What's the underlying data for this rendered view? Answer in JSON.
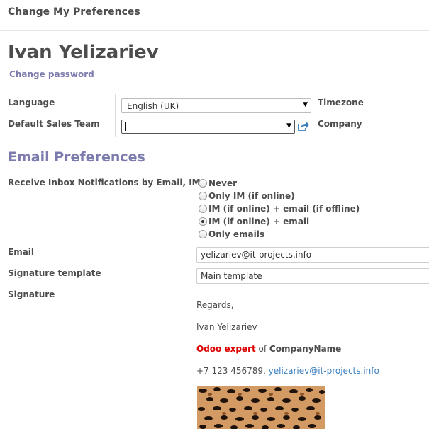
{
  "dialog": {
    "title": "Change My Preferences"
  },
  "user": {
    "name": "Ivan Yelizariev",
    "change_password": "Change password"
  },
  "fields": {
    "language": {
      "label": "Language",
      "value": "English (UK)"
    },
    "default_sales_team": {
      "label": "Default Sales Team",
      "value": ""
    },
    "timezone": {
      "label": "Timezone"
    },
    "company": {
      "label": "Company"
    }
  },
  "email_prefs": {
    "title": "Email Preferences",
    "notify_label": "Receive Inbox Notifications by Email, IM",
    "options": [
      {
        "label": "Never",
        "checked": false
      },
      {
        "label": "Only IM (if online)",
        "checked": false
      },
      {
        "label": "IM (if online) + email (if offline)",
        "checked": false
      },
      {
        "label": "IM (if online) + email",
        "checked": true
      },
      {
        "label": "Only emails",
        "checked": false
      }
    ],
    "email": {
      "label": "Email",
      "value": "yelizariev@it-projects.info"
    },
    "signature_template": {
      "label": "Signature template",
      "value": "Main template"
    },
    "signature": {
      "label": "Signature",
      "line1": "Regards,",
      "line2": "Ivan Yelizariev",
      "role": "Odoo expert",
      "of": " of ",
      "company": "CompanyName",
      "phone": "+7 123 456789, ",
      "email_link": "yelizariev@it-projects.info"
    }
  },
  "icons": {
    "external_link": "external-link-icon",
    "dropdown": "chevron-down-icon"
  }
}
